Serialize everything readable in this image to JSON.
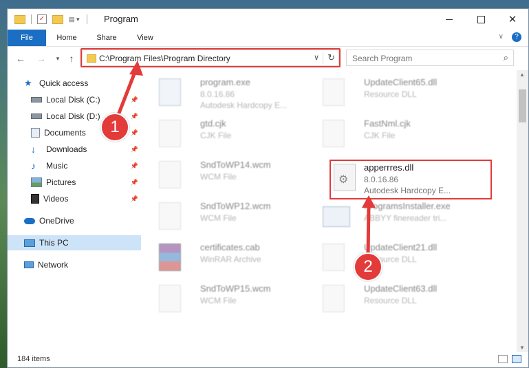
{
  "window": {
    "title": "Program"
  },
  "ribbon": {
    "tabs": [
      "File",
      "Home",
      "Share",
      "View"
    ]
  },
  "address": {
    "path": "C:\\Program Files\\Program Directory"
  },
  "search": {
    "placeholder": "Search Program"
  },
  "sidebar": {
    "items": [
      {
        "label": "Quick access",
        "icon": "star-icon"
      },
      {
        "label": "Local Disk (C:)",
        "icon": "drive-icon",
        "pinned": true
      },
      {
        "label": "Local Disk (D:)",
        "icon": "drive-icon",
        "pinned": true
      },
      {
        "label": "Documents",
        "icon": "documents-icon",
        "pinned": true
      },
      {
        "label": "Downloads",
        "icon": "download-arrow-icon",
        "pinned": true
      },
      {
        "label": "Music",
        "icon": "music-note-icon",
        "pinned": true
      },
      {
        "label": "Pictures",
        "icon": "pictures-icon",
        "pinned": true
      },
      {
        "label": "Videos",
        "icon": "videos-icon",
        "pinned": true
      },
      {
        "label": "OneDrive",
        "icon": "cloud-icon"
      },
      {
        "label": "This PC",
        "icon": "monitor-icon",
        "selected": true
      },
      {
        "label": "Network",
        "icon": "network-icon"
      }
    ]
  },
  "files": [
    {
      "name": "program.exe",
      "line2": "8.0.16.86",
      "line3": "Autodesk Hardcopy E..."
    },
    {
      "name": "UpdateClient65.dll",
      "line2": "Resource DLL",
      "line3": ""
    },
    {
      "name": "gtd.cjk",
      "line2": "CJK File",
      "line3": ""
    },
    {
      "name": "FastNml.cjk",
      "line2": "CJK File",
      "line3": ""
    },
    {
      "name": "SndToWP14.wcm",
      "line2": "WCM File",
      "line3": ""
    },
    {
      "name": "apperrres.dll",
      "line2": "8.0.16.86",
      "line3": "Autodesk Hardcopy E..."
    },
    {
      "name": "SndToWP12.wcm",
      "line2": "WCM File",
      "line3": ""
    },
    {
      "name": "ProgramsInstaller.exe",
      "line2": "ABBYY finereader tri...",
      "line3": ""
    },
    {
      "name": "certificates.cab",
      "line2": "WinRAR Archive",
      "line3": ""
    },
    {
      "name": "UpdateClient21.dll",
      "line2": "Resource DLL",
      "line3": ""
    },
    {
      "name": "SndToWP15.wcm",
      "line2": "WCM File",
      "line3": ""
    },
    {
      "name": "UpdateClient63.dll",
      "line2": "Resource DLL",
      "line3": ""
    }
  ],
  "status": {
    "count": "184 items"
  },
  "callouts": {
    "one": "1",
    "two": "2"
  },
  "colors": {
    "accent": "#1a6fc4",
    "highlight": "#e33a3a",
    "selected": "#cde3f7"
  }
}
